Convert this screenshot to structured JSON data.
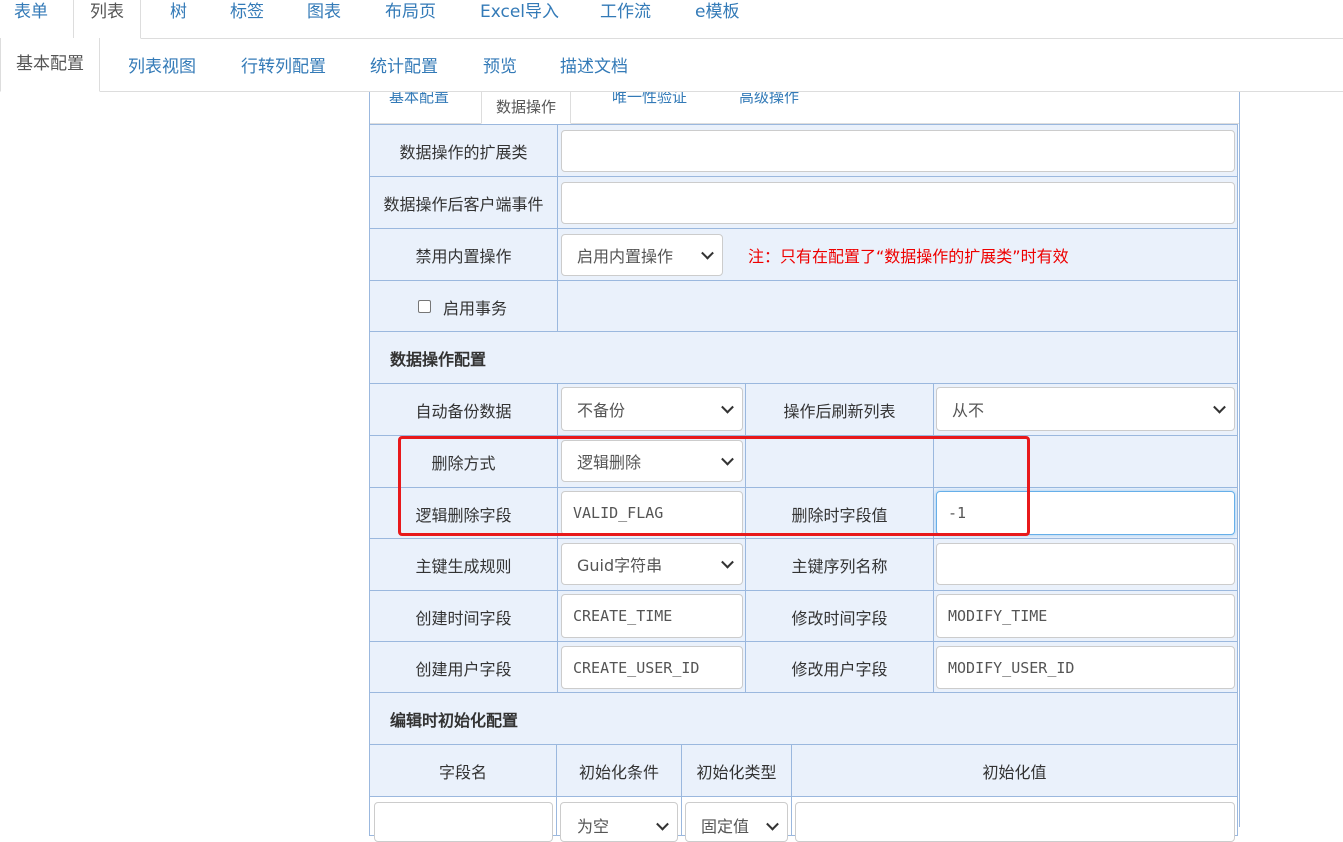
{
  "top_tabs": [
    "表单",
    "列表",
    "树",
    "标签",
    "图表",
    "布局页",
    "Excel导入",
    "工作流",
    "e模板"
  ],
  "sub_tabs": [
    "基本配置",
    "列表视图",
    "行转列配置",
    "统计配置",
    "预览",
    "描述文档"
  ],
  "inner_tabs": [
    "基本配置",
    "数据操作",
    "唯一性验证",
    "高级操作"
  ],
  "form": {
    "ext_class_label": "数据操作的扩展类",
    "ext_class_value": "",
    "client_event_label": "数据操作后客户端事件",
    "client_event_value": "",
    "disable_builtin_label": "禁用内置操作",
    "disable_builtin_value": "启用内置操作",
    "disable_builtin_note": "注：只有在配置了“数据操作的扩展类”时有效",
    "transaction_label": "启用事务",
    "transaction_checked": false
  },
  "data_op_section": "数据操作配置",
  "data_op": {
    "backup_label": "自动备份数据",
    "backup_value": "不备份",
    "refresh_label": "操作后刷新列表",
    "refresh_value": "从不",
    "delete_mode_label": "删除方式",
    "delete_mode_value": "逻辑删除",
    "logic_field_label": "逻辑删除字段",
    "logic_field_value": "VALID_FLAG",
    "delete_value_label": "删除时字段值",
    "delete_value_value": "-1",
    "pk_rule_label": "主键生成规则",
    "pk_rule_value": "Guid字符串",
    "pk_seq_label": "主键序列名称",
    "pk_seq_value": "",
    "create_time_label": "创建时间字段",
    "create_time_value": "CREATE_TIME",
    "modify_time_label": "修改时间字段",
    "modify_time_value": "MODIFY_TIME",
    "create_user_label": "创建用户字段",
    "create_user_value": "CREATE_USER_ID",
    "modify_user_label": "修改用户字段",
    "modify_user_value": "MODIFY_USER_ID"
  },
  "init_section": "编辑时初始化配置",
  "init_table": {
    "headers": [
      "字段名",
      "初始化条件",
      "初始化类型",
      "初始化值"
    ],
    "row1": {
      "field": "",
      "condition": "为空",
      "type": "固定值",
      "value": ""
    }
  },
  "colors": {
    "accent": "#337ab7",
    "table_border": "#9bb8de",
    "cell_bg": "#eaf1fb",
    "note": "#e00000",
    "highlight": "#e8191b"
  }
}
